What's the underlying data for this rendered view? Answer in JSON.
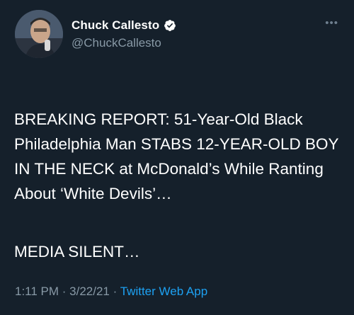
{
  "author": {
    "display_name": "Chuck Callesto",
    "handle": "@ChuckCallesto",
    "verified": true
  },
  "more_icon": "more-horizontal-icon",
  "tweet": {
    "paragraphs": [
      "BREAKING REPORT: 51-Year-Old Black Philadelphia Man STABS 12-YEAR-OLD BOY IN THE NECK at McDonald’s While Ranting About ‘White Devils’…",
      "MEDIA SILENT…"
    ]
  },
  "meta": {
    "time": "1:11 PM",
    "separator": " · ",
    "date": "3/22/21",
    "source": "Twitter Web App"
  },
  "colors": {
    "background": "#15202b",
    "secondary_text": "#8899a6",
    "link": "#1da1f2"
  }
}
